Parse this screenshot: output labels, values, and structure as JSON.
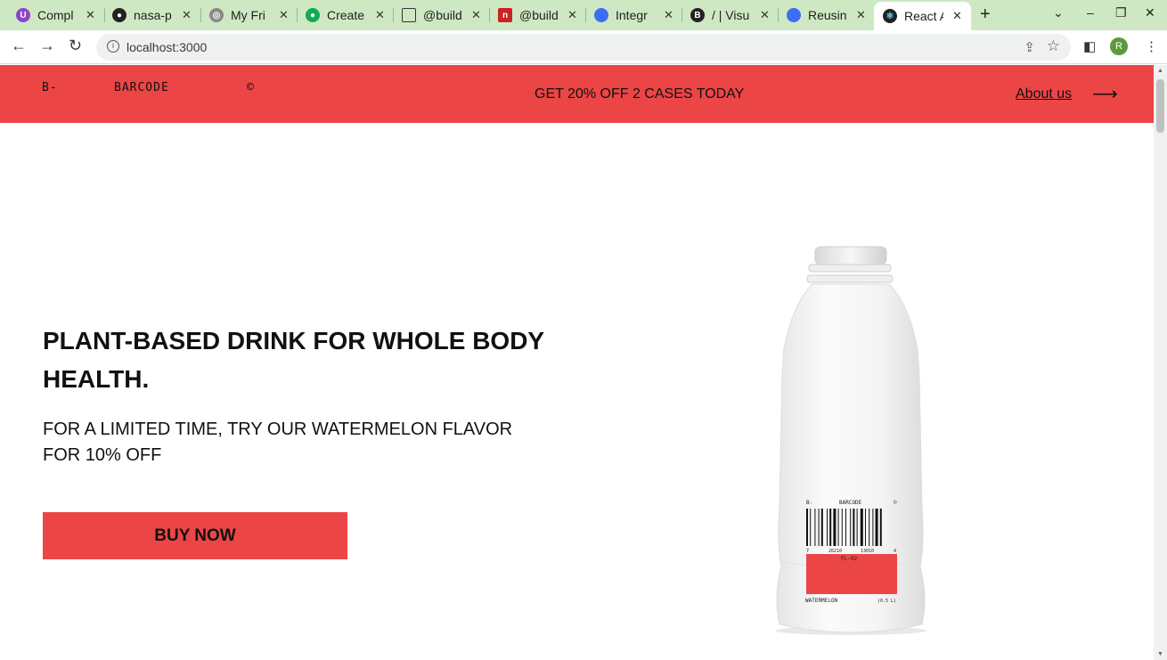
{
  "browser": {
    "tabs": [
      {
        "title": "Compl",
        "color": "#8e44c7",
        "glyph": "U"
      },
      {
        "title": "nasa-p",
        "color": "#222222",
        "glyph": "G"
      },
      {
        "title": "My Fri",
        "color": "#777777",
        "glyph": "W"
      },
      {
        "title": "Create",
        "color": "#13aa52",
        "glyph": "M"
      },
      {
        "title": "@build",
        "color": "#ffffff",
        "glyph": ""
      },
      {
        "title": "@build",
        "color": "#cc2222",
        "glyph": "n"
      },
      {
        "title": "Integr",
        "color": "#3b6ef5",
        "glyph": ""
      },
      {
        "title": "/ | Visu",
        "color": "#222222",
        "glyph": "B"
      },
      {
        "title": "Reusin",
        "color": "#3b6ef5",
        "glyph": ""
      },
      {
        "title": "React A",
        "color": "#222222",
        "glyph": "⚛"
      }
    ],
    "url": "localhost:3000",
    "profile_initial": "R"
  },
  "header": {
    "brand_prefix": "B-",
    "brand_name": "BARCODE",
    "brand_mark": "©",
    "promo": "GET 20% OFF 2 CASES TODAY",
    "about_link": "About us",
    "arrow": "⟶"
  },
  "hero": {
    "title": "PLANT-BASED DRINK FOR WHOLE BODY HEALTH.",
    "subtitle": "FOR A LIMITED TIME, TRY OUR WATERMELON FLAVOR FOR 10% OFF",
    "cta": "BUY NOW"
  },
  "product": {
    "label_brand_prefix": "B-",
    "label_brand_name": "BARCODE",
    "label_brand_mark": "©",
    "barcode_left": "7",
    "barcode_mid1": "26210",
    "barcode_mid2": "13010",
    "barcode_right": "4",
    "code": "FL-02",
    "flavor": "WATERMELON",
    "volume": "(0.5 L)"
  },
  "colors": {
    "accent": "#ec4546",
    "tabstrip": "#cfe8c4"
  }
}
